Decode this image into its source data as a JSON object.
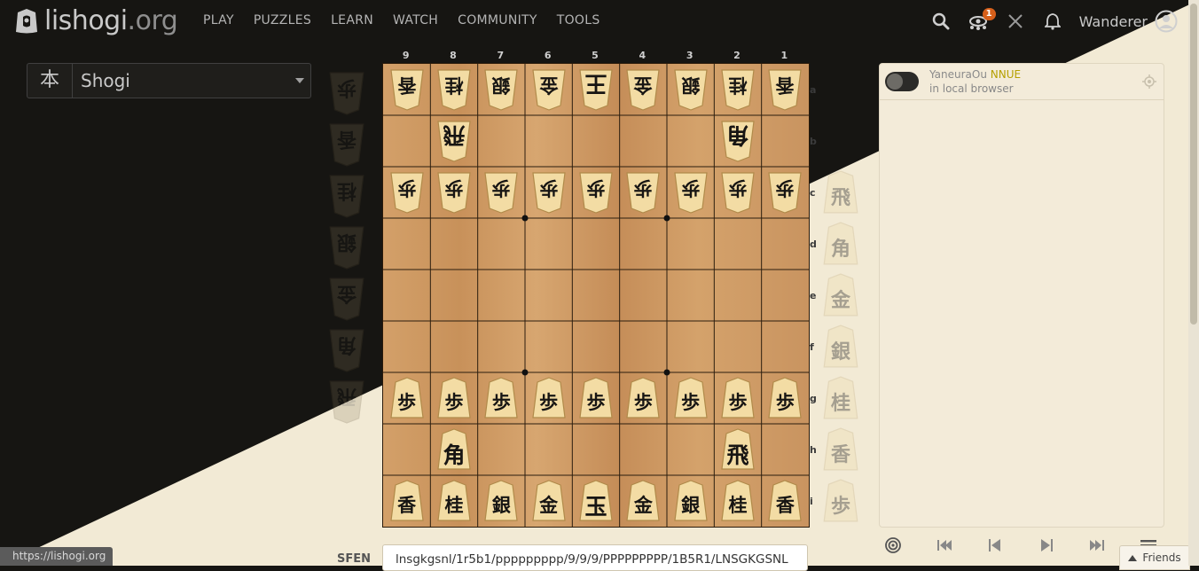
{
  "header": {
    "logo": {
      "name": "lishogi",
      "tld": ".org"
    },
    "nav": [
      "PLAY",
      "PUZZLES",
      "LEARN",
      "WATCH",
      "COMMUNITY",
      "TOOLS"
    ],
    "icons": [
      "search-icon",
      "spectator-icon",
      "crossed-swords-icon",
      "bell-icon"
    ],
    "watch_badge": "1",
    "user": "Wanderer"
  },
  "variant": {
    "icon_glyph": "本",
    "name": "Shogi"
  },
  "board": {
    "files": [
      "9",
      "8",
      "7",
      "6",
      "5",
      "4",
      "3",
      "2",
      "1"
    ],
    "ranks": [
      "a",
      "b",
      "c",
      "d",
      "e",
      "f",
      "g",
      "h",
      "i"
    ],
    "rows": [
      [
        {
          "k": "香",
          "s": "g"
        },
        {
          "k": "桂",
          "s": "g"
        },
        {
          "k": "銀",
          "s": "g"
        },
        {
          "k": "金",
          "s": "g"
        },
        {
          "k": "王",
          "s": "g",
          "big": true
        },
        {
          "k": "金",
          "s": "g"
        },
        {
          "k": "銀",
          "s": "g"
        },
        {
          "k": "桂",
          "s": "g"
        },
        {
          "k": "香",
          "s": "g"
        }
      ],
      [
        null,
        {
          "k": "飛",
          "s": "g",
          "big": true
        },
        null,
        null,
        null,
        null,
        null,
        {
          "k": "角",
          "s": "g",
          "big": true
        },
        null
      ],
      [
        {
          "k": "歩",
          "s": "g"
        },
        {
          "k": "歩",
          "s": "g"
        },
        {
          "k": "歩",
          "s": "g"
        },
        {
          "k": "歩",
          "s": "g"
        },
        {
          "k": "歩",
          "s": "g"
        },
        {
          "k": "歩",
          "s": "g"
        },
        {
          "k": "歩",
          "s": "g"
        },
        {
          "k": "歩",
          "s": "g"
        },
        {
          "k": "歩",
          "s": "g"
        }
      ],
      [
        null,
        null,
        null,
        null,
        null,
        null,
        null,
        null,
        null
      ],
      [
        null,
        null,
        null,
        null,
        null,
        null,
        null,
        null,
        null
      ],
      [
        null,
        null,
        null,
        null,
        null,
        null,
        null,
        null,
        null
      ],
      [
        {
          "k": "歩",
          "s": "s"
        },
        {
          "k": "歩",
          "s": "s"
        },
        {
          "k": "歩",
          "s": "s"
        },
        {
          "k": "歩",
          "s": "s"
        },
        {
          "k": "歩",
          "s": "s"
        },
        {
          "k": "歩",
          "s": "s"
        },
        {
          "k": "歩",
          "s": "s"
        },
        {
          "k": "歩",
          "s": "s"
        },
        {
          "k": "歩",
          "s": "s"
        }
      ],
      [
        null,
        {
          "k": "角",
          "s": "s",
          "big": true
        },
        null,
        null,
        null,
        null,
        null,
        {
          "k": "飛",
          "s": "s",
          "big": true
        },
        null
      ],
      [
        {
          "k": "香",
          "s": "s"
        },
        {
          "k": "桂",
          "s": "s"
        },
        {
          "k": "銀",
          "s": "s"
        },
        {
          "k": "金",
          "s": "s"
        },
        {
          "k": "玉",
          "s": "s",
          "big": true
        },
        {
          "k": "金",
          "s": "s"
        },
        {
          "k": "銀",
          "s": "s"
        },
        {
          "k": "桂",
          "s": "s"
        },
        {
          "k": "香",
          "s": "s"
        }
      ]
    ]
  },
  "hands": {
    "gote": [
      "歩",
      "香",
      "桂",
      "銀",
      "金",
      "角",
      "飛"
    ],
    "sente": [
      "飛",
      "角",
      "金",
      "銀",
      "桂",
      "香",
      "歩"
    ]
  },
  "analysis": {
    "engine_name": "YaneuraOu",
    "engine_tag": "NNUE",
    "engine_location": "in local browser"
  },
  "controls": [
    "target-icon",
    "first-move-icon",
    "prev-move-icon",
    "next-move-icon",
    "last-move-icon",
    "menu-icon"
  ],
  "sfen": {
    "label": "SFEN",
    "value": "lnsgkgsnl/1r5b1/ppppppppp/9/9/9/PPPPPPPPP/1B5R1/LNSGKGSNL"
  },
  "friends_label": "Friends",
  "status_url": "https://lishogi.org",
  "colors": {
    "dark_bg": "#161512",
    "light_bg": "#f2ead5",
    "board": "#d0a06a",
    "accent": "#d65f1a"
  }
}
